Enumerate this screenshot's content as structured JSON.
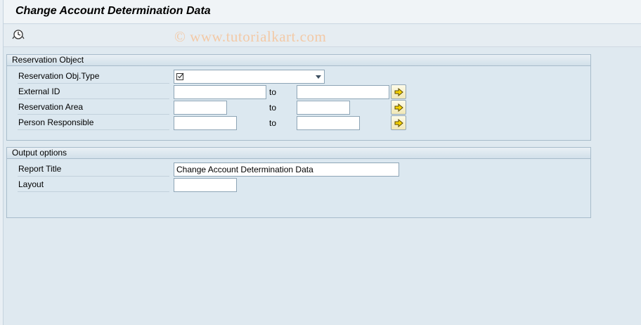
{
  "header": {
    "title": "Change Account Determination Data"
  },
  "toolbar": {
    "watermark": "© www.tutorialkart.com"
  },
  "reservation_object": {
    "heading": "Reservation Object",
    "rows": [
      {
        "label": "Reservation Obj.Type",
        "value": ""
      },
      {
        "label": "External ID",
        "from": "",
        "to_label": "to",
        "to": ""
      },
      {
        "label": "Reservation Area",
        "from": "",
        "to_label": "to",
        "to": ""
      },
      {
        "label": "Person Responsible",
        "from": "",
        "to_label": "to",
        "to": ""
      }
    ]
  },
  "output_options": {
    "heading": "Output options",
    "rows": [
      {
        "label": "Report Title",
        "value": "Change Account Determination Data"
      },
      {
        "label": "Layout",
        "value": ""
      }
    ]
  },
  "icons": {
    "execute": "execute-clock-icon",
    "multiple_selection": "arrow-right-icon",
    "checkbox": "checkbox-icon"
  },
  "colors": {
    "background": "#dfe9f0",
    "selection_button": "#f0e8b6",
    "arrow": "#c9a400"
  }
}
